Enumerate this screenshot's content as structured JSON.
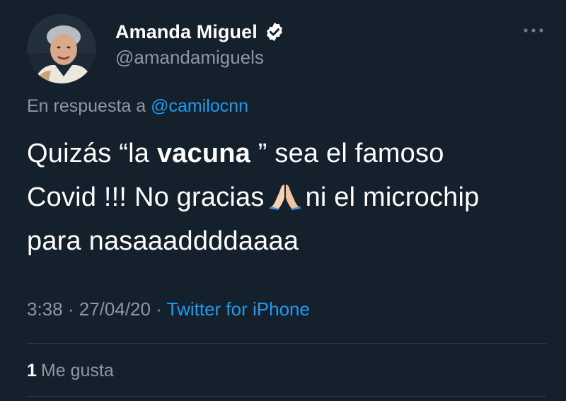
{
  "tweet": {
    "author": {
      "display_name": "Amanda Miguel",
      "handle": "@amandamiguels",
      "verified": true
    },
    "reply": {
      "prefix": "En respuesta a",
      "mention": "@camilocnn"
    },
    "text": {
      "line1_before": "Quizás “la ",
      "line1_bold": "vacuna",
      "line1_after": " ” sea el famoso",
      "line2_before": "Covid !!! No gracias",
      "line2_after": "ni el microchip",
      "line3": "para nasaaaddddaaaa"
    },
    "meta": {
      "time": "3:38",
      "separator1": "·",
      "date": "27/04/20",
      "separator2": "·",
      "source": "Twitter for iPhone"
    },
    "likes": {
      "count": "1",
      "label": "Me gusta"
    }
  },
  "colors": {
    "background": "#14202c",
    "text_primary": "#ffffff",
    "text_secondary": "#8b98a5",
    "accent": "#1d9bf0"
  },
  "icons": {
    "verified": "verified-badge-icon",
    "more": "more-options-icon",
    "emoji": "folded-hands-emoji"
  }
}
